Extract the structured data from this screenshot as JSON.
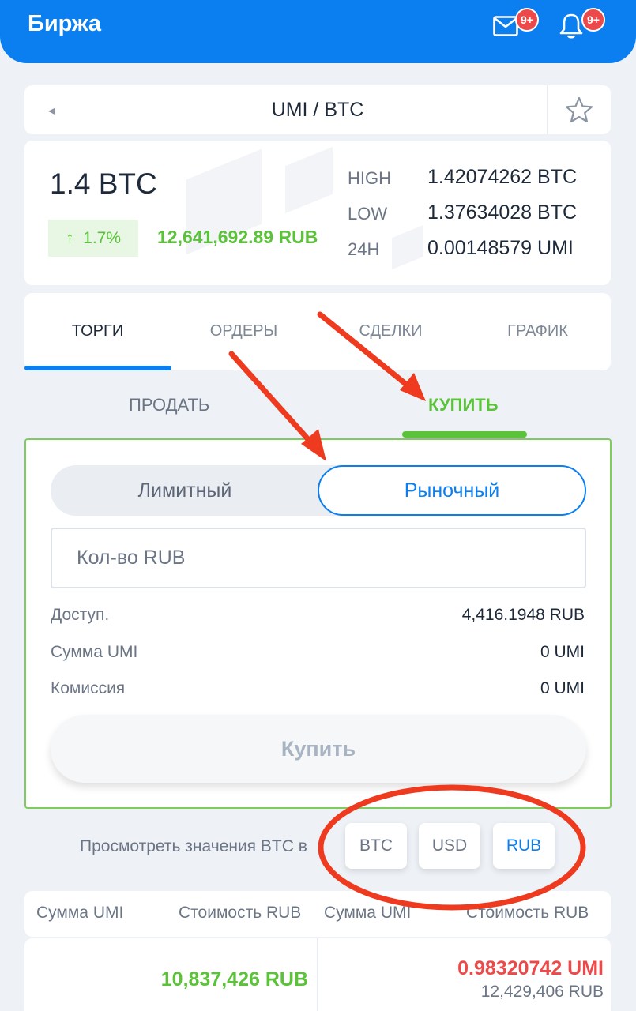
{
  "header": {
    "title": "Биржа",
    "mail_badge": "9+",
    "bell_badge": "9+"
  },
  "pair": {
    "back_icon": "◂",
    "name": "UMI / BTC"
  },
  "price": {
    "value": "1.4 BTC",
    "change": "1.7%",
    "rub_value": "12,641,692.89 RUB",
    "stats": [
      {
        "label": "HIGH",
        "value": "1.42074262 BTC"
      },
      {
        "label": "LOW",
        "value": "1.37634028 BTC"
      },
      {
        "label": "24H",
        "value": "0.00148579 UMI"
      }
    ]
  },
  "tabs": [
    "ТОРГИ",
    "ОРДЕРЫ",
    "СДЕЛКИ",
    "ГРАФИК"
  ],
  "sides": {
    "sell": "ПРОДАТЬ",
    "buy": "КУПИТЬ"
  },
  "order_form": {
    "limit": "Лимитный",
    "market": "Рыночный",
    "amount_placeholder": "Кол-во RUB",
    "available_label": "Доступ.",
    "available_value": "4,416.1948 RUB",
    "sum_label": "Сумма UMI",
    "sum_value": "0 UMI",
    "fee_label": "Комиссия",
    "fee_value": "0 UMI",
    "buy_button": "Купить"
  },
  "view_in": {
    "label": "Просмотреть значения BTC в",
    "options": [
      "BTC",
      "USD",
      "RUB"
    ],
    "selected": "RUB"
  },
  "book": {
    "headers": [
      "Сумма UMI",
      "Стоимость RUB",
      "Сумма UMI",
      "Стоимость RUB"
    ],
    "left_value": "10,837,426 RUB",
    "right_value": "0.98320742 UMI",
    "right_sub": "12,429,406 RUB"
  },
  "colors": {
    "accent": "#0b7ff0",
    "positive": "#5bc23a",
    "negative": "#ec4a4a",
    "annotation": "#ee3a1f"
  },
  "icons": [
    "mail-icon",
    "bell-icon",
    "back-arrow-icon",
    "star-icon",
    "arrow-up-icon"
  ]
}
